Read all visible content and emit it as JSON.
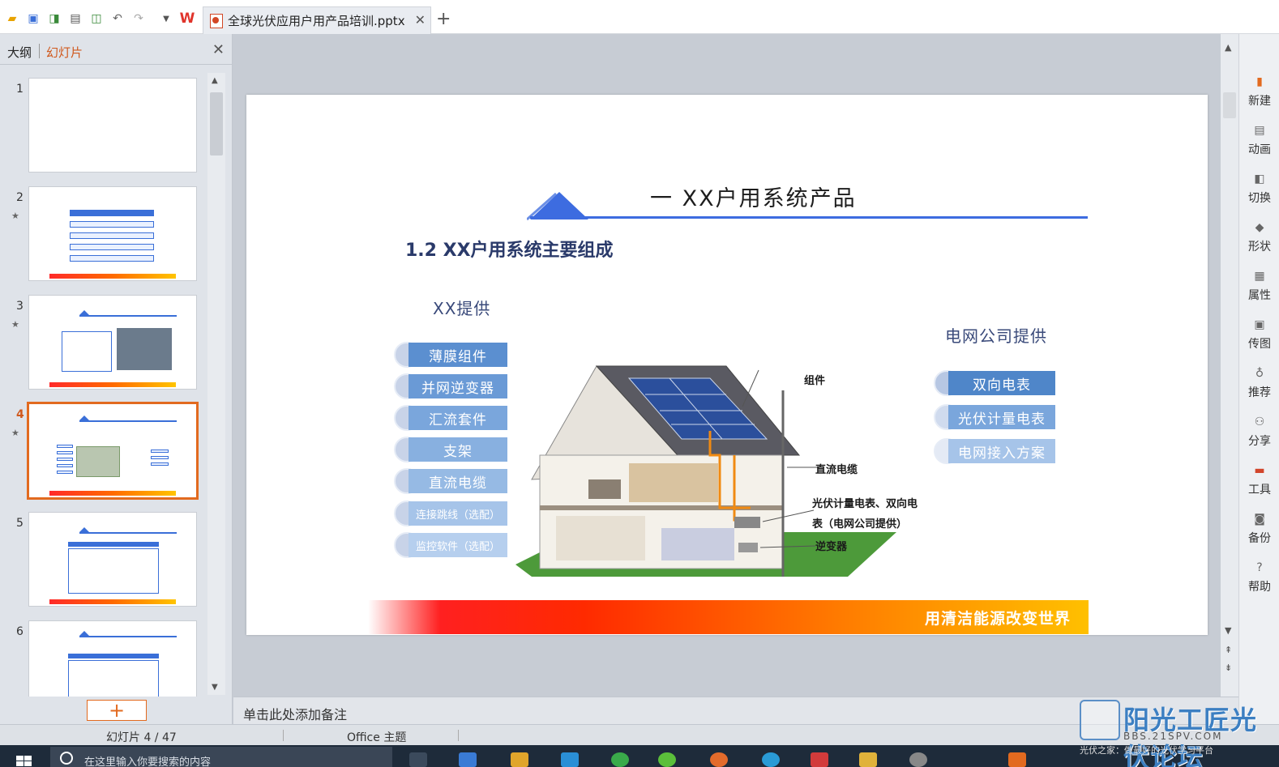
{
  "tab": {
    "title": "全球光伏应用户用产品培训.pptx"
  },
  "left_panel": {
    "tabs": [
      "大纲",
      "幻灯片"
    ],
    "active_tab": "幻灯片",
    "slides": [
      {
        "num": "1"
      },
      {
        "num": "2"
      },
      {
        "num": "3"
      },
      {
        "num": "4"
      },
      {
        "num": "5"
      },
      {
        "num": "6"
      }
    ],
    "star": "★",
    "add_symbol": "+"
  },
  "slide": {
    "title": "一  XX户用系统产品",
    "subtitle": "1.2 XX户用系统主要组成",
    "left_heading": "XX提供",
    "right_heading": "电网公司提供",
    "left_items": [
      "薄膜组件",
      "并网逆变器",
      "汇流套件",
      "支架",
      "直流电缆",
      "连接跳线（选配）",
      "监控软件（选配）"
    ],
    "right_items": [
      "双向电表",
      "光伏计量电表",
      "电网接入方案"
    ],
    "house_labels": {
      "module": "组件",
      "dc_cable": "直流电缆",
      "meter_line1": "光伏计量电表、双向电",
      "meter_line2": "表（电网公司提供）",
      "inverter": "逆变器"
    },
    "slogan": "用清洁能源改变世界"
  },
  "right_sidebar": [
    "新建",
    "动画",
    "切换",
    "形状",
    "属性",
    "传图",
    "推荐",
    "分享",
    "工具",
    "备份",
    "帮助"
  ],
  "notes_placeholder": "单击此处添加备注",
  "status": {
    "slide_pos": "幻灯片 4 / 47",
    "theme": "Office 主题"
  },
  "taskbar": {
    "search_placeholder": "在这里输入你要搜索的内容"
  },
  "watermark": {
    "name": "阳光工匠光伏论坛",
    "url": "BBS.21SPV.COM",
    "tagline": "光伏之家：做最好的光伏学习平台"
  },
  "colors": {
    "accent": "#e26a1f",
    "slide_blue": "#3d6ce0",
    "pill_blue": "#5b8fd0"
  }
}
